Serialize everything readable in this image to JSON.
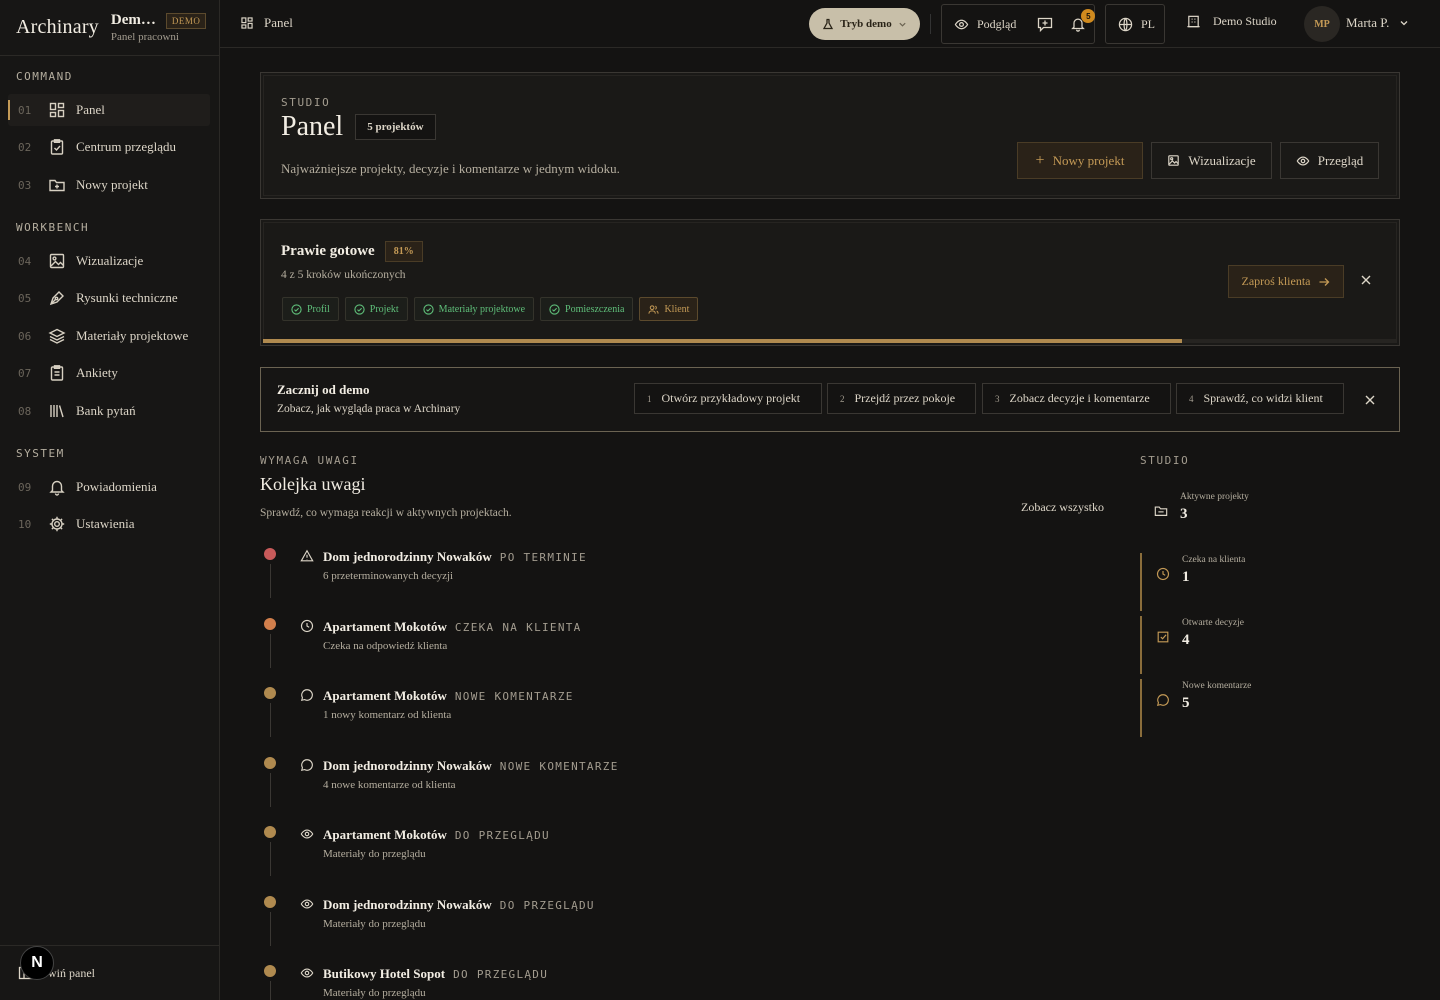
{
  "brand": {
    "logo": "Archinary",
    "name": "Dem…",
    "badge": "DEMO",
    "subtitle": "Panel pracowni"
  },
  "sidebar": {
    "sections": [
      "COMMAND",
      "WORKBENCH",
      "SYSTEM"
    ],
    "items": [
      {
        "num": "01",
        "label": "Panel",
        "icon": "dashboard-icon"
      },
      {
        "num": "02",
        "label": "Centrum przeglądu",
        "icon": "clipboard-icon"
      },
      {
        "num": "03",
        "label": "Nowy projekt",
        "icon": "folder-plus-icon"
      },
      {
        "num": "04",
        "label": "Wizualizacje",
        "icon": "image-icon"
      },
      {
        "num": "05",
        "label": "Rysunki techniczne",
        "icon": "pen-tool-icon"
      },
      {
        "num": "06",
        "label": "Materiały projektowe",
        "icon": "layers-icon"
      },
      {
        "num": "07",
        "label": "Ankiety",
        "icon": "clipboard-list-icon"
      },
      {
        "num": "08",
        "label": "Bank pytań",
        "icon": "library-icon"
      },
      {
        "num": "09",
        "label": "Powiadomienia",
        "icon": "bell-icon"
      },
      {
        "num": "10",
        "label": "Ustawienia",
        "icon": "gear-icon"
      }
    ],
    "footer_label": "wiń panel",
    "n_badge": "N"
  },
  "topbar": {
    "crumb": "Panel",
    "demo_mode": "Tryb demo",
    "preview": "Podgląd",
    "notif_count": "5",
    "lang": "PL",
    "studio": "Demo Studio",
    "avatar": "MP",
    "user": "Marta P."
  },
  "header": {
    "eyebrow": "STUDIO",
    "title": "Panel",
    "count_badge": "5 projektów",
    "subtitle": "Najważniejsze projekty, decyzje i komentarze w jednym widoku.",
    "btn_new": "Nowy projekt",
    "btn_viz": "Wizualizacje",
    "btn_review": "Przegląd"
  },
  "onboarding": {
    "title": "Prawie gotowe",
    "percent": "81%",
    "progress": 0.81,
    "steps_text": "4 z 5 kroków ukończonych",
    "chips": [
      "Profil",
      "Projekt",
      "Materiały projektowe",
      "Pomieszczenia",
      "Klient"
    ],
    "invite": "Zaproś klienta"
  },
  "demo": {
    "title": "Zacznij od demo",
    "subtitle": "Zobacz, jak wygląda praca w Archinary",
    "steps": [
      {
        "num": "1",
        "label": "Otwórz przykładowy projekt"
      },
      {
        "num": "2",
        "label": "Przejdź przez pokoje"
      },
      {
        "num": "3",
        "label": "Zobacz decyzje i komentarze"
      },
      {
        "num": "4",
        "label": "Sprawdź, co widzi klient"
      }
    ]
  },
  "queue": {
    "eyebrow": "WYMAGA UWAGI",
    "title": "Kolejka uwagi",
    "subtitle": "Sprawdź, co wymaga reakcji w aktywnych projektach.",
    "see_all": "Zobacz wszystko",
    "items": [
      {
        "name": "Dom jednorodzinny Nowaków",
        "status": "PO TERMINIE",
        "sub": "6 przeterminowanych decyzji",
        "icon": "warning-icon",
        "color": "#c85a5a"
      },
      {
        "name": "Apartament Mokotów",
        "status": "CZEKA NA KLIENTA",
        "sub": "Czeka na odpowiedź klienta",
        "icon": "clock-icon",
        "color": "#d27f4c"
      },
      {
        "name": "Apartament Mokotów",
        "status": "NOWE KOMENTARZE",
        "sub": "1 nowy komentarz od klienta",
        "icon": "comment-icon",
        "color": "#b08a4f"
      },
      {
        "name": "Dom jednorodzinny Nowaków",
        "status": "NOWE KOMENTARZE",
        "sub": "4 nowe komentarze od klienta",
        "icon": "comment-icon",
        "color": "#b08a4f"
      },
      {
        "name": "Apartament Mokotów",
        "status": "DO PRZEGLĄDU",
        "sub": "Materiały do przeglądu",
        "icon": "eye-icon",
        "color": "#b08a4f"
      },
      {
        "name": "Dom jednorodzinny Nowaków",
        "status": "DO PRZEGLĄDU",
        "sub": "Materiały do przeglądu",
        "icon": "eye-icon",
        "color": "#b08a4f"
      },
      {
        "name": "Butikowy Hotel Sopot",
        "status": "DO PRZEGLĄDU",
        "sub": "Materiały do przeglądu",
        "icon": "eye-icon",
        "color": "#b08a4f"
      }
    ]
  },
  "stats": {
    "eyebrow": "STUDIO",
    "items": [
      {
        "label": "Aktywne projekty",
        "value": "3",
        "icon": "folder-icon"
      },
      {
        "label": "Czeka na klienta",
        "value": "1",
        "icon": "clock-icon"
      },
      {
        "label": "Otwarte decyzje",
        "value": "4",
        "icon": "check-square-icon"
      },
      {
        "label": "Nowe komentarze",
        "value": "5",
        "icon": "comment-icon"
      }
    ]
  }
}
